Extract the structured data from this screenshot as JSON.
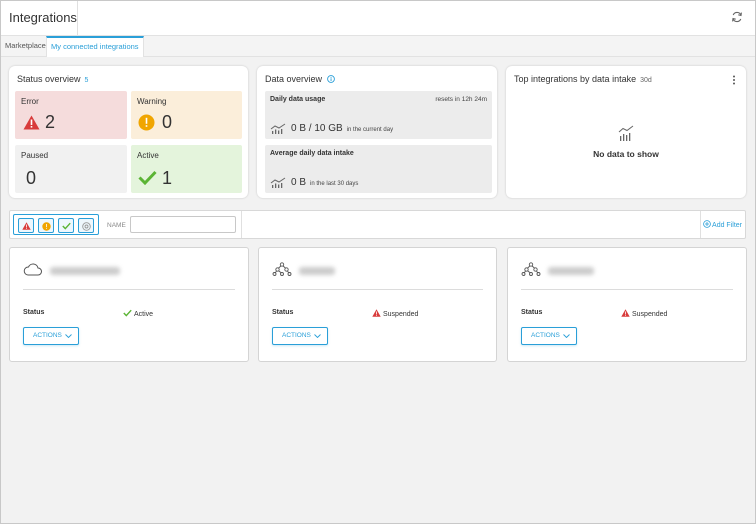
{
  "header": {
    "title": "Integrations",
    "refresh_icon": "refresh-icon"
  },
  "tabs": [
    {
      "label": "Marketplace",
      "active": false
    },
    {
      "label": "My connected integrations",
      "active": true
    }
  ],
  "status_overview": {
    "title": "Status overview",
    "count": "5",
    "tiles": [
      {
        "label": "Error",
        "value": "2",
        "icon": "error-triangle-icon",
        "color": "#f5dcdc"
      },
      {
        "label": "Warning",
        "value": "0",
        "icon": "warning-circle-icon",
        "color": "#fbeeda"
      },
      {
        "label": "Paused",
        "value": "0",
        "icon": "",
        "color": "#f1f1f1"
      },
      {
        "label": "Active",
        "value": "1",
        "icon": "check-icon",
        "color": "#e4f4dc"
      }
    ]
  },
  "data_overview": {
    "title": "Data overview",
    "info_icon": "info-icon",
    "daily": {
      "title": "Daily data usage",
      "reset": "resets in 12h 24m",
      "value": "0 B / 10 GB",
      "sub": "in the current day"
    },
    "average": {
      "title": "Average daily data intake",
      "value": "0 B",
      "sub": "in the last 30 days"
    }
  },
  "top_integrations": {
    "title": "Top integrations by data intake",
    "period": "30d",
    "empty_text": "No data to show"
  },
  "filter": {
    "name_label": "NAME",
    "name_value": "",
    "name_placeholder": "",
    "add_filter": "Add Filter"
  },
  "integrations": [
    {
      "icon": "cloud-icon",
      "status_label": "Status",
      "status": "Active",
      "status_icon": "check-icon",
      "actions_label": "ACTIONS"
    },
    {
      "icon": "network-icon",
      "status_label": "Status",
      "status": "Suspended",
      "status_icon": "error-triangle-icon",
      "actions_label": "ACTIONS"
    },
    {
      "icon": "network-icon",
      "status_label": "Status",
      "status": "Suspended",
      "status_icon": "error-triangle-icon",
      "actions_label": "ACTIONS"
    }
  ],
  "colors": {
    "accent": "#2a9fd8",
    "error": "#d83b3b",
    "warning": "#f0a500",
    "success": "#5bb434"
  }
}
